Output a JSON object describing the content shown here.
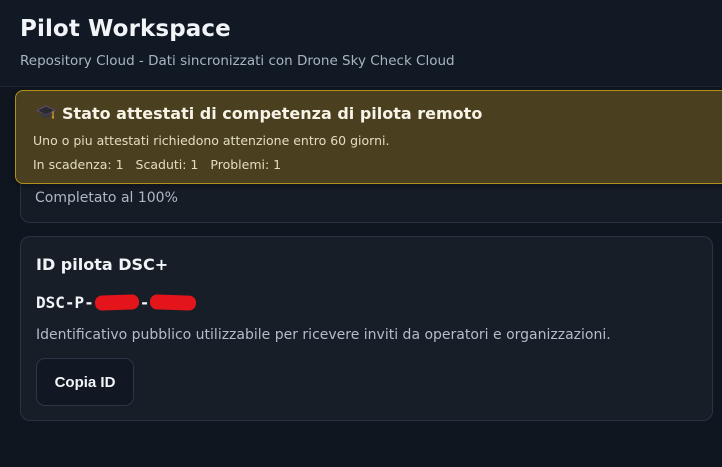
{
  "header": {
    "title": "Pilot Workspace",
    "subtitle": "Repository Cloud - Dati sincronizzati con Drone Sky Check Cloud"
  },
  "progress_card": {
    "text": "Completato al 100%"
  },
  "alert": {
    "icon": "graduation-cap-icon",
    "title": "Stato attestati di competenza di pilota remoto",
    "message": "Uno o piu attestati richiedono attenzione entro 60 giorni.",
    "counts": {
      "expiring": "In scadenza: 1",
      "expired": "Scaduti: 1",
      "problems": "Problemi: 1"
    },
    "colors": {
      "background": "#4a4020",
      "border": "#b38f1a"
    }
  },
  "pilot_id_card": {
    "title": "ID pilota DSC+",
    "id_prefix": "DSC-P-",
    "id_separator": "-",
    "redaction_color": "#e3151a",
    "description": "Identificativo pubblico utilizzabile per ricevere inviti da operatori e organizzazioni.",
    "copy_button_label": "Copia ID"
  }
}
